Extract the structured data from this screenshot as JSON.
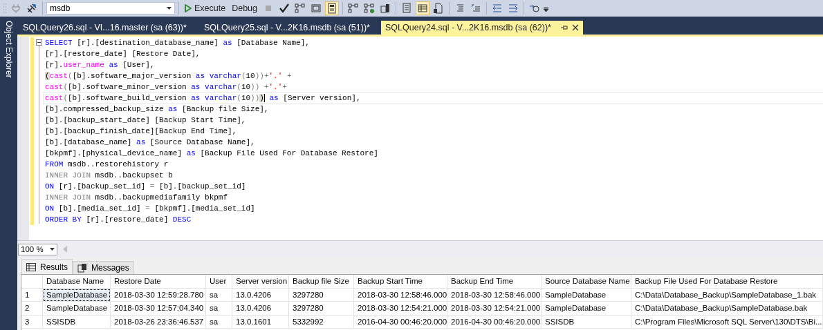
{
  "toolbar": {
    "database": "msdb",
    "execute_label": "Execute",
    "debug_label": "Debug",
    "stop_disabled": true,
    "plug_disabled": true,
    "plan_toggles": [
      {
        "selected": false
      },
      {
        "selected": false
      },
      {
        "selected": true
      }
    ],
    "results_to": [
      {
        "selected": false
      },
      {
        "selected": true
      },
      {
        "selected": false
      }
    ]
  },
  "side_panel": {
    "title": "Object Explorer"
  },
  "tabs": [
    {
      "title": "SQLQuery26.sql - VI...16.master (sa (63))*",
      "selected": false
    },
    {
      "title": "SQLQuery25.sql - V...2K16.msdb (sa (51))*",
      "selected": false
    },
    {
      "title": "SQLQuery24.sql - V...2K16.msdb (sa (62))*",
      "selected": true
    }
  ],
  "editor": {
    "lines": [
      {
        "current": false,
        "tokens": [
          {
            "kind": "kw",
            "text": "SELECT"
          },
          {
            "kind": "txt",
            "text": " [r].[destination_database_name] "
          },
          {
            "kind": "kw",
            "text": "as"
          },
          {
            "kind": "txt",
            "text": " [Database Name],"
          }
        ]
      },
      {
        "current": false,
        "tokens": [
          {
            "kind": "txt",
            "text": "[r].[restore_date] [Restore Date],"
          }
        ]
      },
      {
        "current": false,
        "tokens": [
          {
            "kind": "txt",
            "text": "[r]."
          },
          {
            "kind": "fn",
            "text": "user_name"
          },
          {
            "kind": "kw",
            "text": " as"
          },
          {
            "kind": "txt",
            "text": " [User],"
          }
        ]
      },
      {
        "current": false,
        "tokens": [
          {
            "kind": "brace",
            "text": "("
          },
          {
            "kind": "fn",
            "text": "cast"
          },
          {
            "kind": "op",
            "text": "("
          },
          {
            "kind": "txt",
            "text": "[b].software_major_version "
          },
          {
            "kind": "kw",
            "text": "as"
          },
          {
            "kind": "kw",
            "text": " varchar"
          },
          {
            "kind": "op",
            "text": "("
          },
          {
            "kind": "txt",
            "text": "10"
          },
          {
            "kind": "op",
            "text": "))+"
          },
          {
            "kind": "str",
            "text": "'.'"
          },
          {
            "kind": "op",
            "text": " +"
          }
        ]
      },
      {
        "current": false,
        "tokens": [
          {
            "kind": "fn",
            "text": "cast"
          },
          {
            "kind": "op",
            "text": "("
          },
          {
            "kind": "txt",
            "text": "[b].software_minor_version "
          },
          {
            "kind": "kw",
            "text": "as"
          },
          {
            "kind": "kw",
            "text": " varchar"
          },
          {
            "kind": "op",
            "text": "("
          },
          {
            "kind": "txt",
            "text": "10"
          },
          {
            "kind": "op",
            "text": ")) +"
          },
          {
            "kind": "str",
            "text": "'.'"
          },
          {
            "kind": "op",
            "text": "+"
          }
        ]
      },
      {
        "current": true,
        "tokens": [
          {
            "kind": "fn",
            "text": "cast"
          },
          {
            "kind": "op",
            "text": "("
          },
          {
            "kind": "txt",
            "text": "[b].software_build_version "
          },
          {
            "kind": "kw",
            "text": "as"
          },
          {
            "kind": "kw",
            "text": " varchar"
          },
          {
            "kind": "op",
            "text": "("
          },
          {
            "kind": "txt",
            "text": "10"
          },
          {
            "kind": "op",
            "text": "))"
          },
          {
            "kind": "brace",
            "text": ")"
          },
          {
            "kind": "kw",
            "text": " as"
          },
          {
            "kind": "txt",
            "text": " [Server version],"
          }
        ]
      },
      {
        "current": false,
        "tokens": [
          {
            "kind": "txt",
            "text": "[b].compressed_backup_size "
          },
          {
            "kind": "kw",
            "text": "as"
          },
          {
            "kind": "txt",
            "text": " [Backup file Size],"
          }
        ]
      },
      {
        "current": false,
        "tokens": [
          {
            "kind": "txt",
            "text": "[b].[backup_start_date] [Backup Start Time],"
          }
        ]
      },
      {
        "current": false,
        "tokens": [
          {
            "kind": "txt",
            "text": "[b].[backup_finish_date][Backup End Time],"
          }
        ]
      },
      {
        "current": false,
        "tokens": [
          {
            "kind": "txt",
            "text": "[b].[database_name] "
          },
          {
            "kind": "kw",
            "text": "as"
          },
          {
            "kind": "txt",
            "text": " [Source Database Name],"
          }
        ]
      },
      {
        "current": false,
        "tokens": [
          {
            "kind": "txt",
            "text": "[bkpmf].[physical_device_name] "
          },
          {
            "kind": "kw",
            "text": "as"
          },
          {
            "kind": "txt",
            "text": " [Backup File Used For Database Restore]"
          }
        ]
      },
      {
        "current": false,
        "tokens": [
          {
            "kind": "kw",
            "text": "FROM"
          },
          {
            "kind": "txt",
            "text": " msdb..restorehistory r"
          }
        ]
      },
      {
        "current": false,
        "tokens": [
          {
            "kind": "op",
            "text": "INNER JOIN"
          },
          {
            "kind": "txt",
            "text": " msdb..backupset b"
          }
        ]
      },
      {
        "current": false,
        "tokens": [
          {
            "kind": "kw",
            "text": "ON"
          },
          {
            "kind": "txt",
            "text": " [r].[backup_set_id] "
          },
          {
            "kind": "op",
            "text": "="
          },
          {
            "kind": "txt",
            "text": " [b].[backup_set_id]"
          }
        ]
      },
      {
        "current": false,
        "tokens": [
          {
            "kind": "op",
            "text": "INNER JOIN"
          },
          {
            "kind": "txt",
            "text": " msdb..backupmediafamily bkpmf"
          }
        ]
      },
      {
        "current": false,
        "tokens": [
          {
            "kind": "kw",
            "text": "ON"
          },
          {
            "kind": "txt",
            "text": " [b].[media_set_id] "
          },
          {
            "kind": "op",
            "text": "="
          },
          {
            "kind": "txt",
            "text": " [bkpmf].[media_set_id]"
          }
        ]
      },
      {
        "current": false,
        "tokens": [
          {
            "kind": "kw",
            "text": "ORDER BY"
          },
          {
            "kind": "txt",
            "text": " [r].[restore_date] "
          },
          {
            "kind": "kw",
            "text": "DESC"
          }
        ]
      }
    ]
  },
  "zoom": "100 %",
  "result_tabs": [
    {
      "label": "Results",
      "selected": true
    },
    {
      "label": "Messages",
      "selected": false
    }
  ],
  "grid": {
    "columns": [
      "Database Name",
      "Restore Date",
      "User",
      "Server version",
      "Backup file Size",
      "Backup Start Time",
      "Backup End Time",
      "Source Database Name",
      "Backup File Used For Database Restore"
    ],
    "rows": [
      {
        "number": "1",
        "cells": [
          {
            "text": "SampleDatabase",
            "focused": true
          },
          {
            "text": "2018-03-30 12:59:28.780",
            "focused": false
          },
          {
            "text": "sa",
            "focused": false
          },
          {
            "text": "13.0.4206",
            "focused": false
          },
          {
            "text": "3297280",
            "focused": false
          },
          {
            "text": "2018-03-30 12:58:46.000",
            "focused": false
          },
          {
            "text": "2018-03-30 12:58:46.000",
            "focused": false
          },
          {
            "text": "SampleDatabase",
            "focused": false
          },
          {
            "text": "C:\\Data\\Database_Backup\\SampleDatabase_1.bak",
            "focused": false
          }
        ]
      },
      {
        "number": "2",
        "cells": [
          {
            "text": "SampleDatabase",
            "focused": false
          },
          {
            "text": "2018-03-30 12:57:04.340",
            "focused": false
          },
          {
            "text": "sa",
            "focused": false
          },
          {
            "text": "13.0.4206",
            "focused": false
          },
          {
            "text": "3297280",
            "focused": false
          },
          {
            "text": "2018-03-30 12:54:21.000",
            "focused": false
          },
          {
            "text": "2018-03-30 12:54:21.000",
            "focused": false
          },
          {
            "text": "SampleDatabase",
            "focused": false
          },
          {
            "text": "C:\\Data\\Database_Backup\\SampleDatabase.bak",
            "focused": false
          }
        ]
      },
      {
        "number": "3",
        "cells": [
          {
            "text": "SSISDB",
            "focused": false
          },
          {
            "text": "2018-03-26 23:36:46.537",
            "focused": false
          },
          {
            "text": "sa",
            "focused": false
          },
          {
            "text": "13.0.1601",
            "focused": false
          },
          {
            "text": "5332992",
            "focused": false
          },
          {
            "text": "2016-04-30 00:46:20.000",
            "focused": false
          },
          {
            "text": "2016-04-30 00:46:20.000",
            "focused": false
          },
          {
            "text": "SSISDB",
            "focused": false
          },
          {
            "text": "C:\\Program Files\\Microsoft SQL Server\\130\\DTS\\Bi...",
            "focused": false
          }
        ]
      }
    ]
  }
}
